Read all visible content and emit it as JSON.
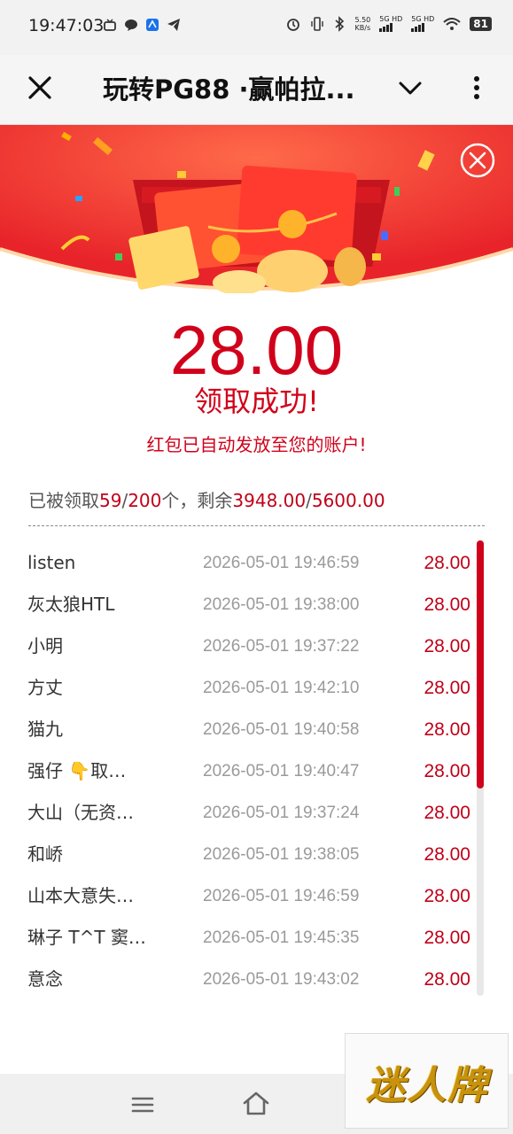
{
  "status_bar": {
    "time": "19:47:03",
    "speed_value": "5.50",
    "speed_unit": "KB/s",
    "net1": "5G HD",
    "net2": "5G HD",
    "battery": "81"
  },
  "app_bar": {
    "title": "玩转PG88 ·赢帕拉..."
  },
  "result": {
    "amount": "28.00",
    "status": "领取成功!",
    "hint": "红包已自动发放至您的账户!"
  },
  "summary": {
    "prefix": "已被领取",
    "claimed": "59",
    "sep1": "/",
    "total": "200",
    "mid": "个，剩余",
    "remaining": "3948.00",
    "sep2": "/",
    "total_amount": "5600.00"
  },
  "records": [
    {
      "name": "listen",
      "time": "2026-05-01 19:46:59",
      "amount": "28.00"
    },
    {
      "name": "灰太狼HTL",
      "time": "2026-05-01 19:38:00",
      "amount": "28.00"
    },
    {
      "name": "小明",
      "time": "2026-05-01 19:37:22",
      "amount": "28.00"
    },
    {
      "name": "方丈",
      "time": "2026-05-01 19:42:10",
      "amount": "28.00"
    },
    {
      "name": "猫九",
      "time": "2026-05-01 19:40:58",
      "amount": "28.00"
    },
    {
      "name": "强仔 👇取…",
      "time": "2026-05-01 19:40:47",
      "amount": "28.00"
    },
    {
      "name": "大山（无资…",
      "time": "2026-05-01 19:37:24",
      "amount": "28.00"
    },
    {
      "name": "和峤",
      "time": "2026-05-01 19:38:05",
      "amount": "28.00"
    },
    {
      "name": "山本大意失…",
      "time": "2026-05-01 19:46:59",
      "amount": "28.00"
    },
    {
      "name": "琳子 T^T 窦…",
      "time": "2026-05-01 19:45:35",
      "amount": "28.00"
    },
    {
      "name": "意念",
      "time": "2026-05-01 19:43:02",
      "amount": "28.00"
    }
  ],
  "watermark": {
    "text": "迷人牌"
  },
  "icons": {
    "close": "close-icon",
    "dropdown": "chevron-down-icon",
    "more": "more-vertical-icon",
    "banner_close": "circle-close-icon",
    "nav_menu": "menu-icon",
    "nav_home": "home-icon"
  },
  "colors": {
    "accent_red": "#d0021b",
    "banner_red": "#f0452e"
  }
}
